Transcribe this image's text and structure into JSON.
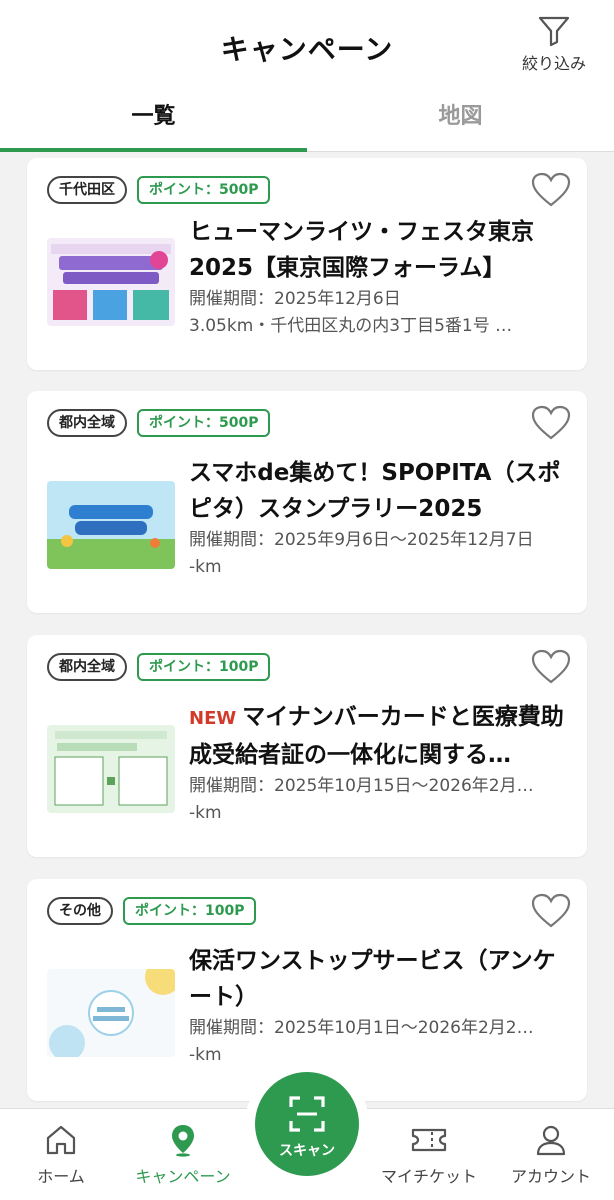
{
  "header": {
    "title": "キャンペーン",
    "filter_label": "絞り込み"
  },
  "tabs": [
    {
      "label": "一覧",
      "active": true
    },
    {
      "label": "地図",
      "active": false
    }
  ],
  "cards": [
    {
      "area": "千代田区",
      "points": "ポイント：500P",
      "new": false,
      "title": "ヒューマンライツ・フェスタ東京2025【東京国際フォーラム】",
      "period": "開催期間：2025年12月6日",
      "distance": "3.05km・千代田区丸の内3丁目5番1号 …",
      "thumb_icon": "human-rights-festa-banner"
    },
    {
      "area": "都内全域",
      "points": "ポイント：500P",
      "new": false,
      "title": "スマホde集めて！SPOPITA（スポピタ）スタンプラリー2025",
      "period": "開催期間：2025年9月6日～2025年12月7日",
      "distance": "-km",
      "thumb_icon": "spopita-banner"
    },
    {
      "area": "都内全域",
      "points": "ポイント：100P",
      "new": true,
      "new_label": "NEW",
      "title": "マイナンバーカードと医療費助成受給者証の一体化に関する…",
      "period": "開催期間：2025年10月15日～2026年2月…",
      "distance": "-km",
      "thumb_icon": "mynumber-survey-banner"
    },
    {
      "area": "その他",
      "points": "ポイント：100P",
      "new": false,
      "title": "保活ワンストップサービス（アンケート）",
      "period": "開催期間：2025年10月1日～2026年2月2…",
      "distance": "-km",
      "thumb_icon": "hokatsu-banner"
    }
  ],
  "nav": {
    "home": "ホーム",
    "campaign": "キャンペーン",
    "scan": "スキャン",
    "ticket": "マイチケット",
    "account": "アカウント"
  },
  "colors": {
    "accent": "#2e9a4f",
    "new": "#d23a2a"
  }
}
